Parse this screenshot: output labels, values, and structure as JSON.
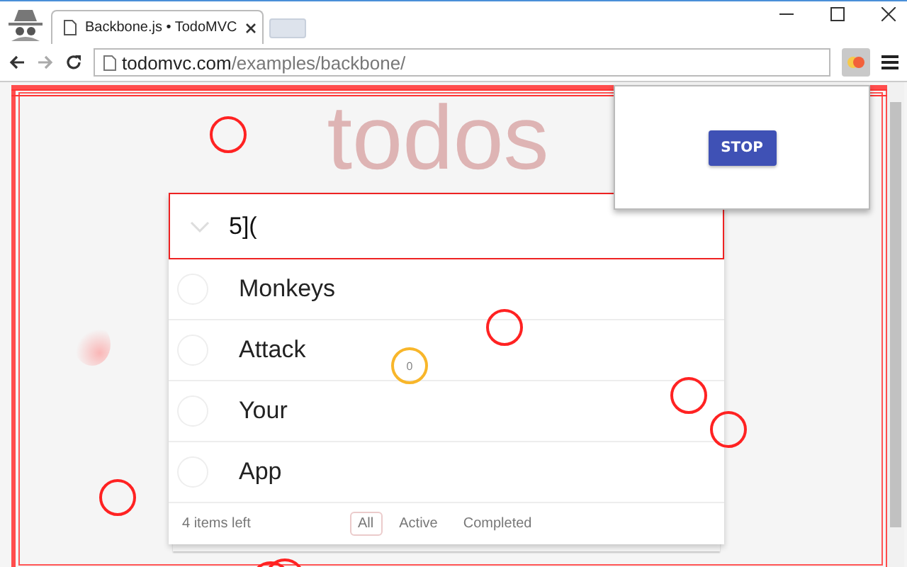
{
  "browser": {
    "tab_title": "Backbone.js • TodoMVC",
    "url_host": "todomvc.com",
    "url_path": "/examples/backbone/"
  },
  "app": {
    "title": "todos",
    "new_todo": "5](",
    "todos": [
      {
        "text": "Monkeys",
        "completed": false
      },
      {
        "text": "Attack",
        "completed": false
      },
      {
        "text": "Your",
        "completed": false
      },
      {
        "text": "App",
        "completed": false
      }
    ],
    "count": "4 items left",
    "filters": [
      {
        "label": "All",
        "selected": true
      },
      {
        "label": "Active",
        "selected": false
      },
      {
        "label": "Completed",
        "selected": false
      }
    ]
  },
  "popup": {
    "button": "STOP"
  },
  "marker": {
    "label": "0"
  }
}
